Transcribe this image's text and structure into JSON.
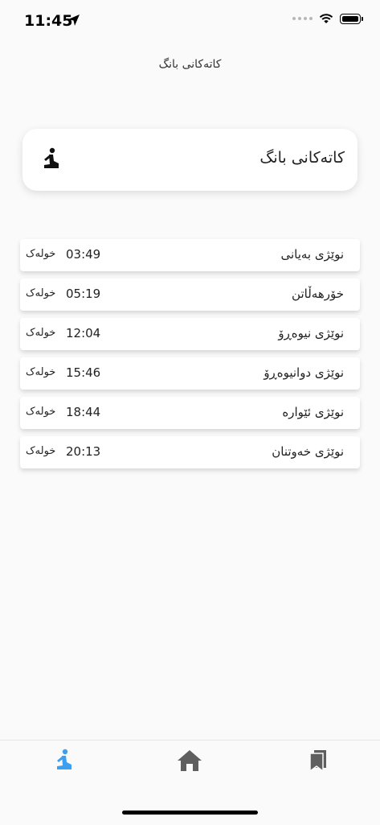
{
  "status_bar": {
    "time": "11:45"
  },
  "app_title": "کاتەکانی بانگ",
  "header_card": {
    "title": "کاتەکانی بانگ",
    "icon": "praying-person-icon"
  },
  "prayers": [
    {
      "name": "نوێژی بەیانی",
      "time": "03:49",
      "unit": "خولەک"
    },
    {
      "name": "خۆرهەڵاتن",
      "time": "05:19",
      "unit": "خولەک"
    },
    {
      "name": "نوێژی نیوەڕۆ",
      "time": "12:04",
      "unit": "خولەک"
    },
    {
      "name": "نوێژی دوانیوەڕۆ",
      "time": "15:46",
      "unit": "خولەک"
    },
    {
      "name": "نوێژی ئێوارە",
      "time": "18:44",
      "unit": "خولەک"
    },
    {
      "name": "نوێژی خەوتنان",
      "time": "20:13",
      "unit": "خولەک"
    }
  ],
  "tabs": [
    {
      "icon": "praying-person-icon",
      "active": true
    },
    {
      "icon": "home-icon",
      "active": false
    },
    {
      "icon": "bookmarks-icon",
      "active": false
    }
  ],
  "colors": {
    "accent": "#3d9ff0",
    "inactive_icon": "#5f5f5f",
    "background": "#fafafa"
  }
}
